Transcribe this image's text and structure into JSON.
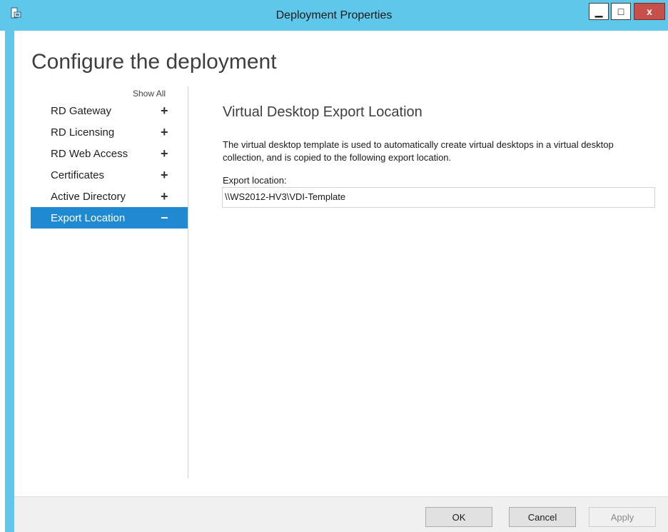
{
  "window": {
    "title": "Deployment Properties",
    "minimize_glyph": "▁",
    "maximize_glyph": "□",
    "close_glyph": "x"
  },
  "page": {
    "title": "Configure the deployment",
    "show_all": "Show All"
  },
  "nav": {
    "items": [
      {
        "label": "RD Gateway",
        "sign": "+"
      },
      {
        "label": "RD Licensing",
        "sign": "+"
      },
      {
        "label": "RD Web Access",
        "sign": "+"
      },
      {
        "label": "Certificates",
        "sign": "+"
      },
      {
        "label": "Active Directory",
        "sign": "+"
      },
      {
        "label": "Export Location",
        "sign": "−",
        "selected": true
      }
    ]
  },
  "content": {
    "section_title": "Virtual Desktop Export Location",
    "description": "The virtual desktop template is used to automatically create virtual desktops in a virtual desktop collection, and is copied to the following export location.",
    "export_label": "Export location:",
    "export_value": "\\\\WS2012-HV3\\VDI-Template"
  },
  "footer": {
    "ok": "OK",
    "cancel": "Cancel",
    "apply": "Apply"
  },
  "colors": {
    "titlebar": "#5fc8ea",
    "selected": "#1f8ad1",
    "close": "#c7504a"
  }
}
